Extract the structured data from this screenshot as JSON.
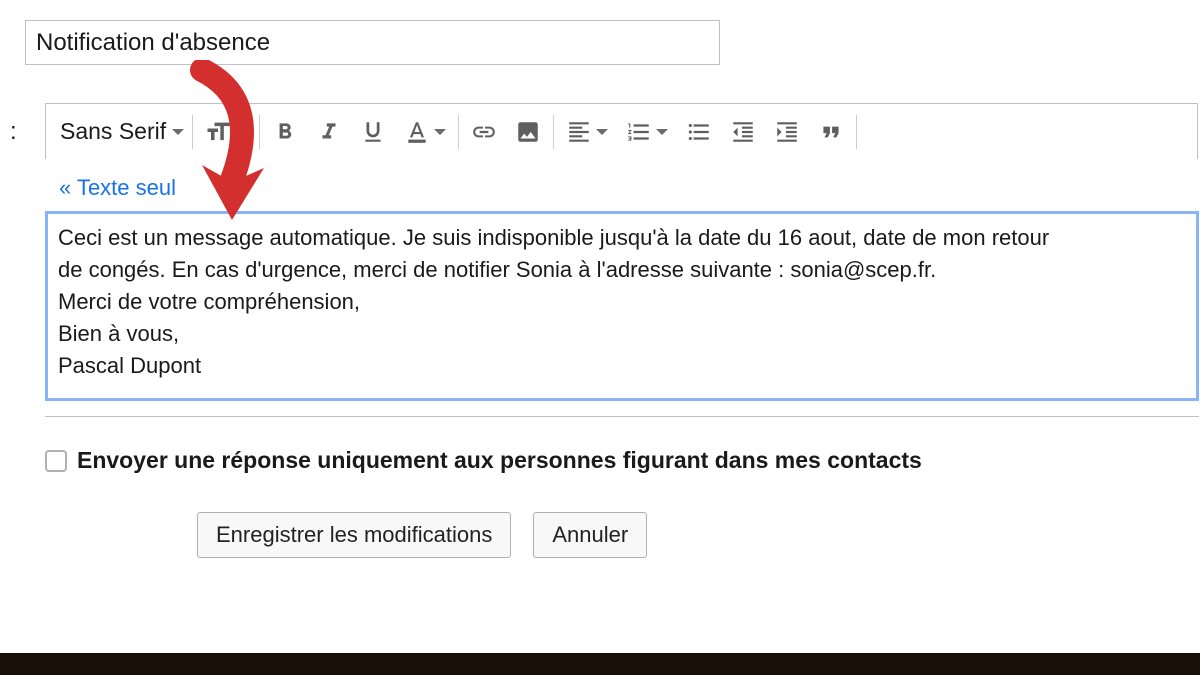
{
  "subject": {
    "value": "Notification d'absence"
  },
  "toolbar": {
    "font_family_label": "Sans Serif"
  },
  "text_only_link": "« Texte seul",
  "message": {
    "line1": "Ceci est un message automatique. Je suis indisponible jusqu'à la date du 16 aout, date de mon retour",
    "line2": "de congés. En cas d'urgence, merci de notifier Sonia à l'adresse suivante : sonia@scep.fr.",
    "line3": "Merci de votre compréhension,",
    "line4": "Bien à vous,",
    "line5": "Pascal Dupont"
  },
  "checkbox_label": "Envoyer une réponse uniquement aux personnes figurant dans mes contacts",
  "buttons": {
    "save": "Enregistrer les modifications",
    "cancel": "Annuler"
  }
}
